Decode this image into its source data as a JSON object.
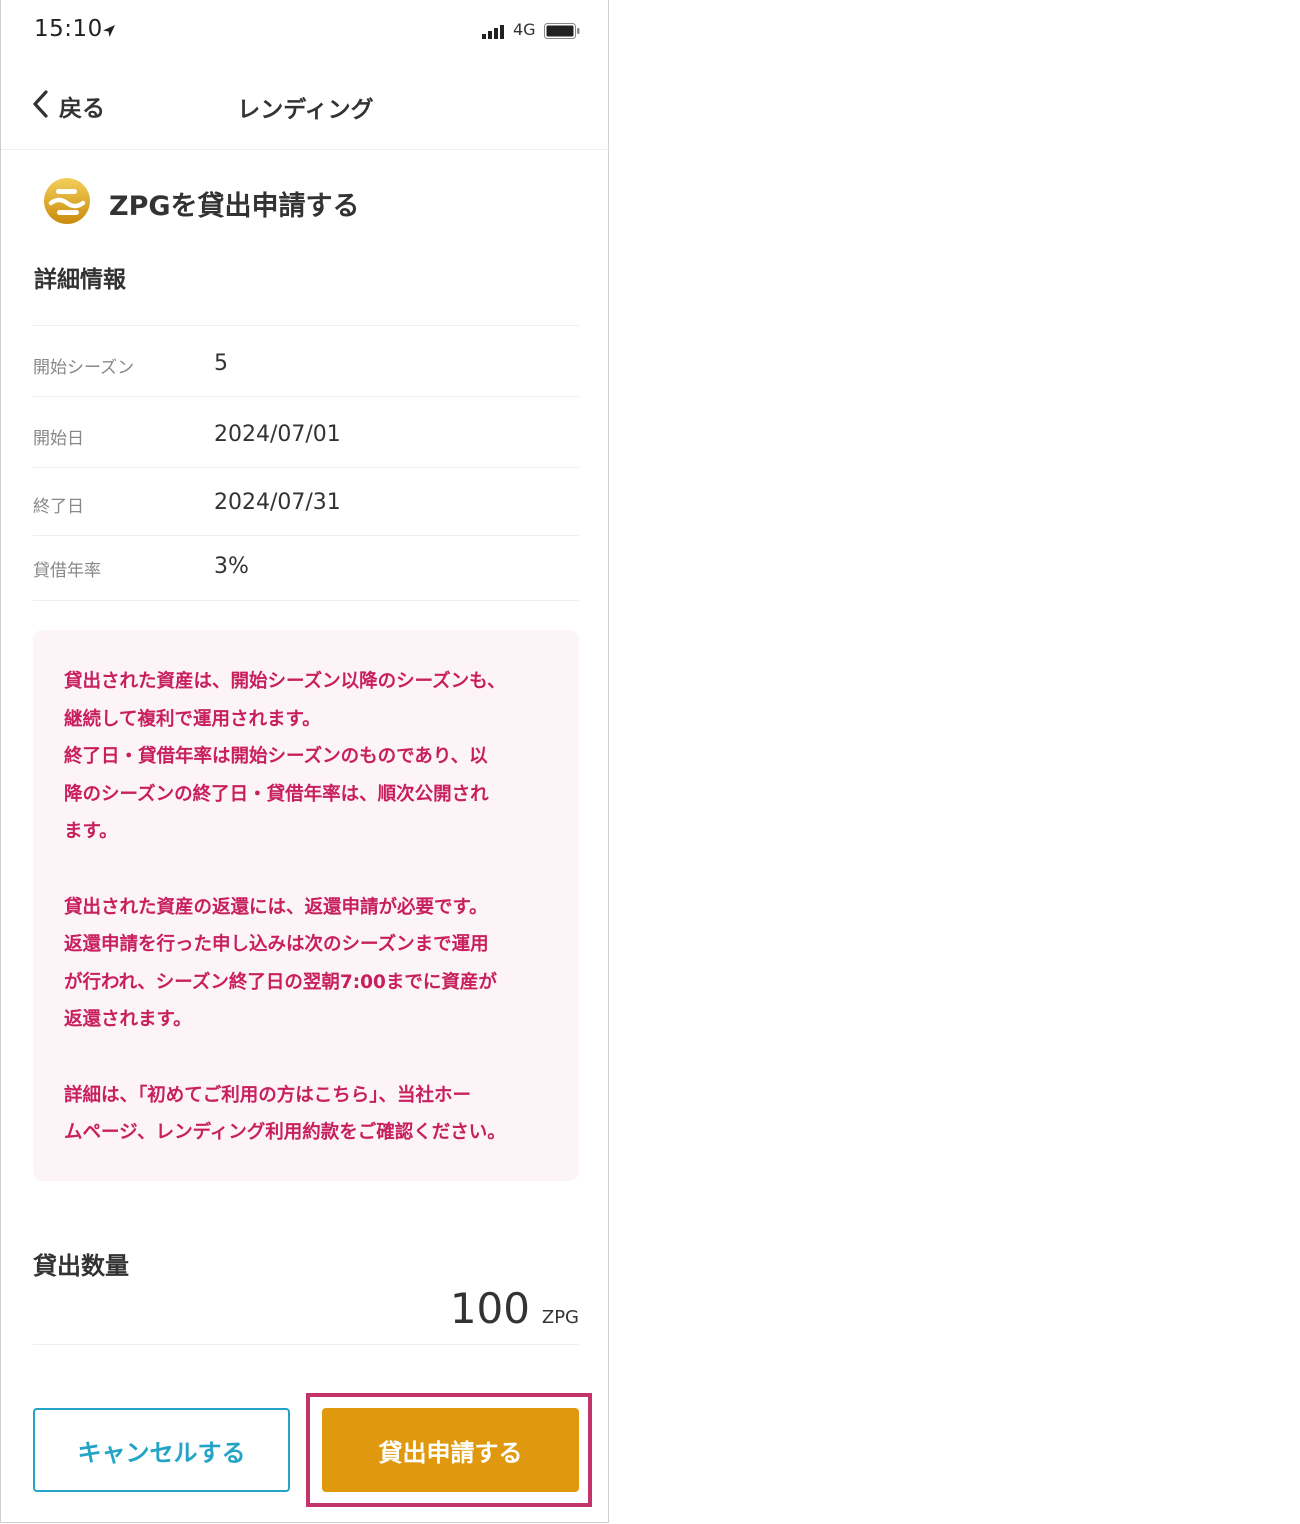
{
  "status_bar": {
    "time": "15:10",
    "network": "4G"
  },
  "nav": {
    "back_label": "戻る",
    "title": "レンディング"
  },
  "heading": {
    "title": "ZPGを貸出申請する"
  },
  "details": {
    "section_title": "詳細情報",
    "rows": [
      {
        "label": "開始シーズン",
        "value": "5"
      },
      {
        "label": "開始日",
        "value": "2024/07/01"
      },
      {
        "label": "終了日",
        "value": "2024/07/31"
      },
      {
        "label": "貸借年率",
        "value": "3%"
      }
    ]
  },
  "notice": {
    "para1": "貸出された資産は、開始シーズン以降のシーズンも、\n継続して複利で運用されます。\n終了日・貸借年率は開始シーズンのものであり、以\n降のシーズンの終了日・貸借年率は、順次公開され\nます。",
    "para2": "貸出された資産の返還には、返還申請が必要です。\n返還申請を行った申し込みは次のシーズンまで運用\nが行われ、シーズン終了日の翌朝7:00までに資産が\n返還されます。",
    "para3": "詳細は、「初めてご利用の方はこちら」、当社ホー\nムページ、レンディング利用約款をご確認ください。"
  },
  "quantity": {
    "label": "貸出数量",
    "value": "100",
    "unit": "ZPG"
  },
  "buttons": {
    "cancel_label": "キャンセルする",
    "submit_label": "貸出申請する"
  },
  "colors": {
    "accent_cyan": "#23a4c6",
    "submit_orange": "#e0990f",
    "notice_red": "#c8205d",
    "notice_bg": "#fdf4f7",
    "highlight_border": "#c2346a",
    "coin_gold": "#e0a516"
  },
  "icons": {
    "location": "location-arrow-icon",
    "signal": "signal-bars-icon",
    "battery": "battery-icon",
    "back": "chevron-left-icon",
    "coin": "zpg-coin-icon"
  }
}
